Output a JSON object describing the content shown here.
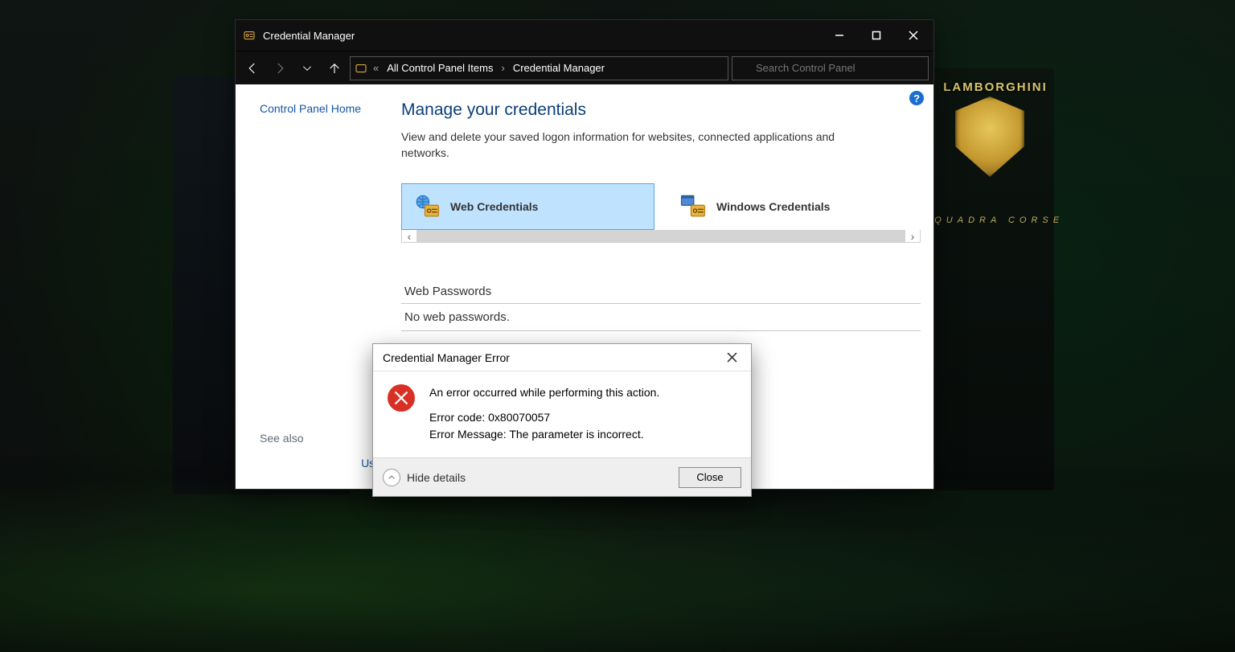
{
  "titlebar": {
    "caption": "Credential Manager"
  },
  "nav": {
    "breadcrumb": {
      "prefix": "«",
      "items": [
        "All Control Panel Items",
        "Credential Manager"
      ]
    },
    "search_placeholder": "Search Control Panel"
  },
  "sidebar": {
    "home": "Control Panel Home",
    "see_also_label": "See also",
    "see_also_link": "User Accounts"
  },
  "main": {
    "heading": "Manage your credentials",
    "description": "View and delete your saved logon information for websites, connected applications and networks.",
    "tiles": [
      {
        "label": "Web Credentials",
        "selected": true
      },
      {
        "label": "Windows Credentials",
        "selected": false
      }
    ],
    "section_title": "Web Passwords",
    "section_empty": "No web passwords."
  },
  "dialog": {
    "title": "Credential Manager Error",
    "message": "An error occurred while performing this action.",
    "code_label": "Error code: 0x80070057",
    "err_msg_label": "Error Message: The parameter is incorrect.",
    "hide_details": "Hide details",
    "close": "Close"
  },
  "wallpaper": {
    "brand": "LAMBORGHINI",
    "sub": "SQUADRA CORSE"
  }
}
